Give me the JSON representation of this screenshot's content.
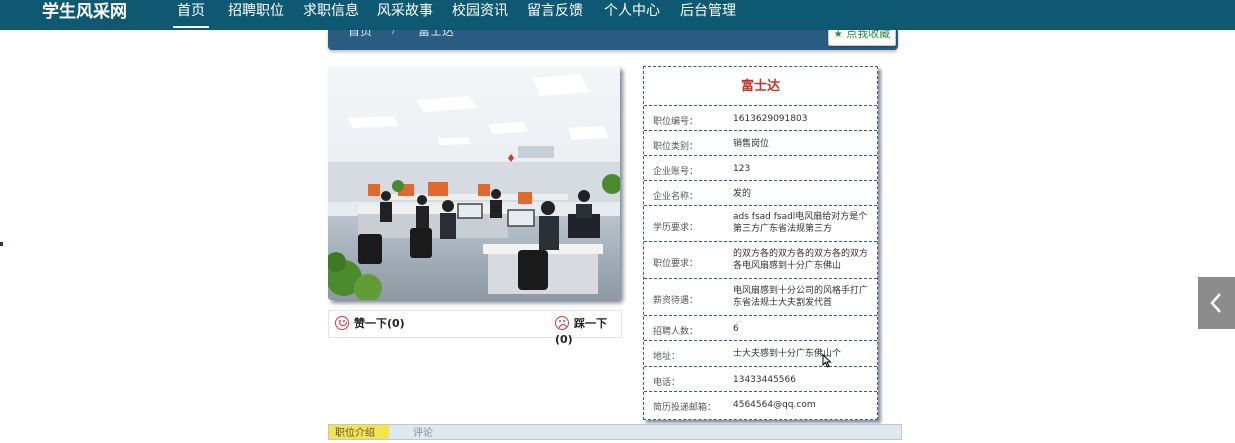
{
  "nav": {
    "brand": "学生风采网",
    "items": [
      "首页",
      "招聘职位",
      "求职信息",
      "风采故事",
      "校园资讯",
      "留言反馈",
      "个人中心",
      "后台管理"
    ]
  },
  "breadcrumb": {
    "home": "首页",
    "separator": "/",
    "current": "富士达"
  },
  "favorite": {
    "label": "点我收藏",
    "icon": "star-icon"
  },
  "job": {
    "title": "富士达",
    "fields": [
      {
        "label": "职位编号：",
        "value": "1613629091803"
      },
      {
        "label": "职位类别：",
        "value": "销售岗位"
      },
      {
        "label": "企业账号：",
        "value": "123"
      },
      {
        "label": "企业名称：",
        "value": "发的"
      },
      {
        "label": "学历要求：",
        "value": "ads fsad fsadl电风扇给对方是个第三方广东省法规第三方"
      },
      {
        "label": "职位要求：",
        "value": "的双方各的双方各的双方各的双方各电风扇感到十分广东佛山"
      },
      {
        "label": "薪资待遇：",
        "value": "电风扇感到十分公司的风格手打广东省法规士大夫割发代首"
      },
      {
        "label": "招聘人数：",
        "value": "6"
      },
      {
        "label": "地址：",
        "value": "士大夫感到十分广东佛山个"
      },
      {
        "label": "电话：",
        "value": "13433445566"
      },
      {
        "label": "简历投递邮箱：",
        "value": "4564564@qq.com"
      }
    ]
  },
  "votes": {
    "like": "赞一下(0)",
    "dislike": "踩一下(0)"
  },
  "tabs": {
    "intro": "职位介绍",
    "comment": "评论"
  },
  "colors": {
    "nav_bg": "#0e5872",
    "crumb_bg": "#2b5d82",
    "title_red": "#c0392b",
    "border": "#3d5a80"
  }
}
